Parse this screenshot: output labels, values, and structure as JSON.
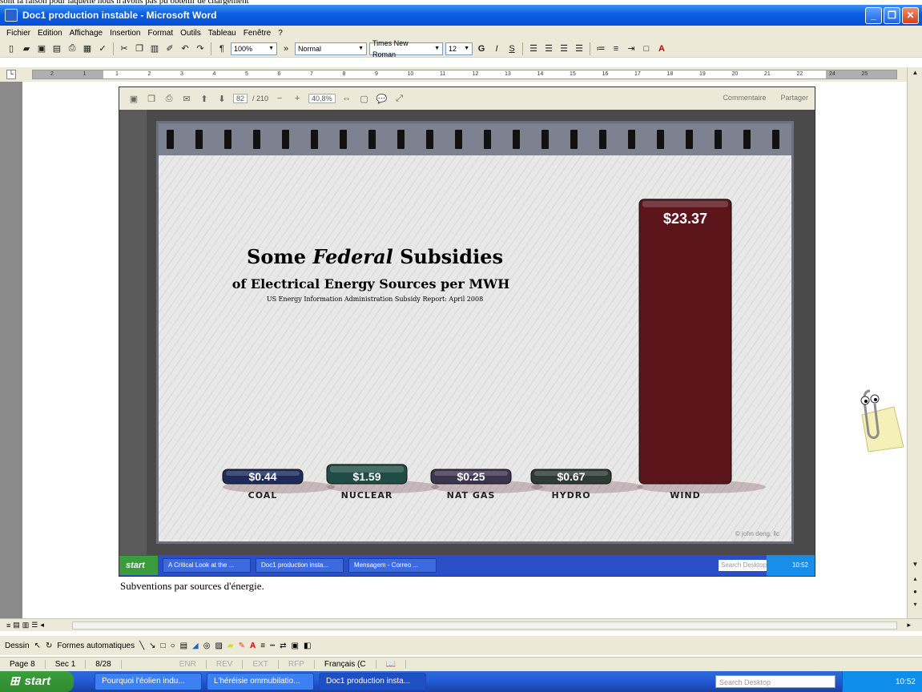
{
  "top_text": "sont la raison pour laquelle nous n'avons pas pu obtenir de chargement",
  "window": {
    "title": "Doc1 production instable - Microsoft Word"
  },
  "menu": [
    "Fichier",
    "Edition",
    "Affichage",
    "Insertion",
    "Format",
    "Outils",
    "Tableau",
    "Fenêtre",
    "?"
  ],
  "toolbar": {
    "zoom": "100%",
    "style": "Normal",
    "font": "Times New Roman",
    "size": "12"
  },
  "ruler_labels": [
    "2",
    "1",
    "1",
    "2",
    "3",
    "4",
    "5",
    "6",
    "7",
    "8",
    "9",
    "10",
    "11",
    "12",
    "13",
    "14",
    "15",
    "16",
    "17",
    "18",
    "19",
    "20",
    "21",
    "22",
    "24",
    "25"
  ],
  "shot": {
    "toolbar": {
      "page": "82",
      "pages": "/ 210",
      "zoom": "40,8%",
      "comment": "Commentaire",
      "share": "Partager"
    },
    "taskbar": {
      "start": "start",
      "tasks": [
        "A Critical Look at the ...",
        "Doc1 production insta...",
        "Mensagem - Correo ..."
      ],
      "search": "Search Desktop",
      "clock": "10:52"
    }
  },
  "chart_data": {
    "type": "bar",
    "title": "Some Federal Subsidies",
    "title_parts": [
      "Some ",
      "Federal",
      " Subsidies"
    ],
    "subtitle": "of Electrical Energy Sources per MWH",
    "source": "US Energy Information Administration Subsidy Report: April 2008",
    "categories": [
      "COAL",
      "NUCLEAR",
      "NAT GAS",
      "HYDRO",
      "WIND"
    ],
    "values": [
      0.44,
      1.59,
      0.25,
      0.67,
      23.37
    ],
    "value_labels": [
      "$0.44",
      "$1.59",
      "$0.25",
      "$0.67",
      "$23.37"
    ],
    "colors": [
      "#1d2a5a",
      "#1f4d45",
      "#3d3550",
      "#2d3a35",
      "#5a141a"
    ],
    "credit": "© john deng, llc",
    "ylim": [
      0,
      25
    ]
  },
  "caption": "Subventions par sources d'énergie.",
  "drawbar": {
    "draw": "Dessin",
    "autoshapes": "Formes automatiques"
  },
  "status": {
    "page": "Page 8",
    "sec": "Sec 1",
    "pos": "8/28",
    "flags": [
      "ENR",
      "REV",
      "EXT",
      "RFP"
    ],
    "lang": "Français (C"
  },
  "taskbar": {
    "start": "start",
    "tasks": [
      "Pourquoi l'éolien indu...",
      "L'héréisie ommubilatio...",
      "Doc1 production insta..."
    ],
    "search": "Search Desktop",
    "clock": "10:52"
  }
}
